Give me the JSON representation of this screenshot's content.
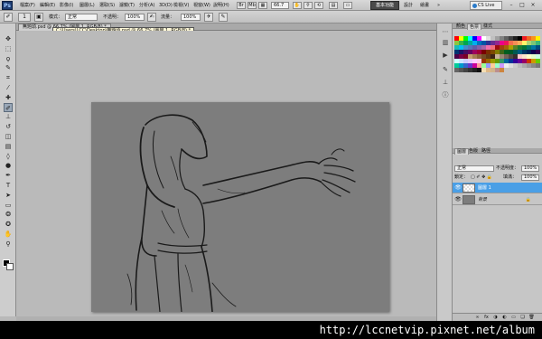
{
  "menubar": {
    "logo": "Ps",
    "items": [
      "檔案(F)",
      "編輯(E)",
      "影像(I)",
      "圖層(L)",
      "選取(S)",
      "濾鏡(T)",
      "分析(A)",
      "3D(D)",
      "檢視(V)",
      "視窗(W)",
      "說明(H)"
    ],
    "zoom": "66.7",
    "workspaces": [
      "基本功能",
      "設計",
      "繪畫",
      "»"
    ],
    "cslive": "CS Live",
    "win_controls": [
      "–",
      "□",
      "×"
    ]
  },
  "options": {
    "brush_size": "1",
    "mode_label": "模式：",
    "mode_value": "正常",
    "opacity_label": "不透明：",
    "opacity_value": "100%",
    "flow_label": "流量：",
    "flow_value": "100%"
  },
  "document": {
    "tab_label": "無題頭.psd @ 66.7% (圖層 1, RGB/8) *",
    "tooltip": "C:\\Users\\LCC\\Desktop\\無題頭.psd @ 66.7% (圖層 1, RGB/8) *"
  },
  "tools": [
    {
      "name": "move-tool-icon",
      "glyph": "✥"
    },
    {
      "name": "marquee-tool-icon",
      "glyph": "⬚"
    },
    {
      "name": "lasso-tool-icon",
      "glyph": "ϙ"
    },
    {
      "name": "quick-select-tool-icon",
      "glyph": "✎"
    },
    {
      "name": "crop-tool-icon",
      "glyph": "⌗"
    },
    {
      "name": "eyedropper-tool-icon",
      "glyph": "⁄"
    },
    {
      "name": "healing-tool-icon",
      "glyph": "✚"
    },
    {
      "name": "brush-tool-icon",
      "glyph": "✐"
    },
    {
      "name": "clone-stamp-tool-icon",
      "glyph": "⊥"
    },
    {
      "name": "history-brush-tool-icon",
      "glyph": "↺"
    },
    {
      "name": "eraser-tool-icon",
      "glyph": "◫"
    },
    {
      "name": "gradient-tool-icon",
      "glyph": "▤"
    },
    {
      "name": "blur-tool-icon",
      "glyph": "◊"
    },
    {
      "name": "dodge-tool-icon",
      "glyph": "●"
    },
    {
      "name": "pen-tool-icon",
      "glyph": "✒"
    },
    {
      "name": "type-tool-icon",
      "glyph": "T"
    },
    {
      "name": "path-select-tool-icon",
      "glyph": "➤"
    },
    {
      "name": "shape-tool-icon",
      "glyph": "▭"
    },
    {
      "name": "3d-rotate-tool-icon",
      "glyph": "❂"
    },
    {
      "name": "3d-camera-tool-icon",
      "glyph": "✪"
    },
    {
      "name": "hand-tool-icon",
      "glyph": "✋"
    },
    {
      "name": "zoom-tool-icon",
      "glyph": "⚲"
    }
  ],
  "panels": {
    "top_tabs": [
      "顏色",
      "色票",
      "樣式"
    ],
    "layer_tabs": [
      "圖層",
      "色版",
      "路徑"
    ],
    "blend_mode": "正常",
    "opacity_label": "不透明度：",
    "opacity_value": "100%",
    "lock_label": "鎖定：",
    "fill_label": "填滿：",
    "fill_value": "100%",
    "layers": [
      {
        "name": "圖層 1",
        "selected": true,
        "lock": ""
      },
      {
        "name": "背景",
        "selected": false,
        "lock": "🔒"
      }
    ],
    "bottom_icons": [
      "link-icon",
      "fx-icon",
      "mask-icon",
      "adjustment-icon",
      "folder-icon",
      "new-layer-icon",
      "trash-icon"
    ]
  },
  "swatch_colors": [
    "#ff0000",
    "#ffff00",
    "#00ff00",
    "#00ffff",
    "#0000ff",
    "#ff00ff",
    "#ffffff",
    "#e0e0e0",
    "#c0c0c0",
    "#a0a0a0",
    "#808080",
    "#606060",
    "#404040",
    "#202020",
    "#000000",
    "#ee1c24",
    "#f26522",
    "#f7941d",
    "#fff200",
    "#8dc63f",
    "#39b54a",
    "#00a651",
    "#00a99d",
    "#00aeef",
    "#0072bc",
    "#0054a6",
    "#2e3192",
    "#662d91",
    "#92278f",
    "#ec008c",
    "#ed145b",
    "#f26c4f",
    "#f68e55",
    "#fbaf5c",
    "#fff468",
    "#acd373",
    "#7cc576",
    "#3bb878",
    "#1abbb4",
    "#00bff3",
    "#448ccb",
    "#5674b9",
    "#605ca8",
    "#855fa8",
    "#a763a8",
    "#f06eaa",
    "#f26d7d",
    "#9e0b0f",
    "#a0410d",
    "#a3620a",
    "#aba000",
    "#598527",
    "#197b30",
    "#007236",
    "#00746b",
    "#0076a3",
    "#004b80",
    "#003471",
    "#1b1464",
    "#440e62",
    "#630460",
    "#9e005d",
    "#9e0039",
    "#790000",
    "#7b2e00",
    "#7d4900",
    "#827b00",
    "#406618",
    "#005e20",
    "#005826",
    "#005952",
    "#005b7f",
    "#003663",
    "#002157",
    "#0d004c",
    "#32004b",
    "#4b0049",
    "#7b0046",
    "#7a0026",
    "#c69c6d",
    "#a67c52",
    "#8c6239",
    "#754c24",
    "#603913",
    "#3c2415",
    "#c7b299",
    "#998675",
    "#736357",
    "#534741",
    "#362f2d",
    "#ffcccc",
    "#ffe5cc",
    "#ffffcc",
    "#e5ffcc",
    "#ccffe5",
    "#ccffff",
    "#cce5ff",
    "#ccccff",
    "#e5ccff",
    "#ffccff",
    "#ffccea",
    "#993300",
    "#996600",
    "#999900",
    "#669900",
    "#339966",
    "#006699",
    "#003399",
    "#330099",
    "#660099",
    "#990066",
    "#cc3300",
    "#cc9900",
    "#66cc00",
    "#00cc99",
    "#0099cc",
    "#3366cc",
    "#6633cc",
    "#cc0099",
    "#ff9999",
    "#99ff99",
    "#9999ff",
    "#ffcc99",
    "#99ffcc",
    "#cc99ff",
    "#eeeeee",
    "#dddddd",
    "#cccccc",
    "#bbbbbb",
    "#aaaaaa",
    "#999999",
    "#888888",
    "#777777",
    "#666666",
    "#555555",
    "#444444",
    "#333333",
    "#222222",
    "#111111",
    "#f5deb3",
    "#deb887",
    "#d2b48c",
    "#bc8f8f",
    "#cd853f"
  ],
  "colors": {
    "foreground": "#000000",
    "background": "#ffffff",
    "canvas": "#7d7d7d",
    "selected_layer": "#4a9fe6"
  },
  "watermark": "http://lccnetvip.pixnet.net/album"
}
